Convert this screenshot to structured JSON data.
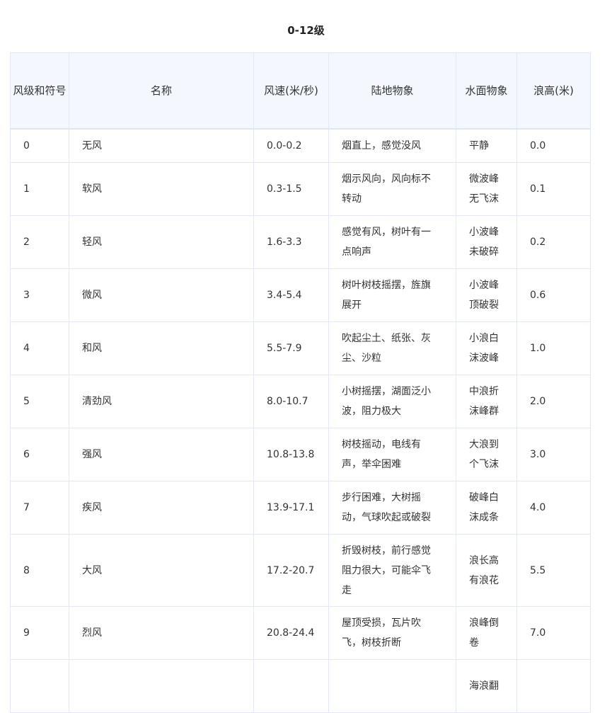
{
  "caption": "0-12级",
  "headers": {
    "level": [
      "风级",
      "和符",
      "号"
    ],
    "name": "名称",
    "speed": [
      "风速",
      "(米/",
      "秒)"
    ],
    "land": "陆地物象",
    "water": [
      "水面",
      "物象"
    ],
    "wave": [
      "浪高",
      "(米)"
    ]
  },
  "rows": [
    {
      "level": "0",
      "name": "无风",
      "speed": "0.0-0.2",
      "land": [
        "烟直上，感觉没风"
      ],
      "water": [
        "平静"
      ],
      "wave": "0.0"
    },
    {
      "level": "1",
      "name": "软风",
      "speed": "0.3-1.5",
      "land": [
        "烟示风向，风向标不",
        "转动"
      ],
      "water": [
        "微波峰",
        "无飞沫"
      ],
      "wave": "0.1"
    },
    {
      "level": "2",
      "name": "轻风",
      "speed": "1.6-3.3",
      "land": [
        "感觉有风，树叶有一",
        "点响声"
      ],
      "water": [
        "小波峰",
        "未破碎"
      ],
      "wave": "0.2"
    },
    {
      "level": "3",
      "name": "微风",
      "speed": "3.4-5.4",
      "land": [
        "树叶树枝摇摆，旌旗",
        "展开"
      ],
      "water": [
        "小波峰",
        "顶破裂"
      ],
      "wave": "0.6"
    },
    {
      "level": "4",
      "name": "和风",
      "speed": "5.5-7.9",
      "land": [
        "吹起尘土、纸张、灰",
        "尘、沙粒"
      ],
      "water": [
        "小浪白",
        "沫波峰"
      ],
      "wave": "1.0"
    },
    {
      "level": "5",
      "name": "清劲风",
      "speed": "8.0-10.7",
      "land": [
        "小树摇摆，湖面泛小",
        "波，阻力极大"
      ],
      "water": [
        "中浪折",
        "沫峰群"
      ],
      "wave": "2.0"
    },
    {
      "level": "6",
      "name": "强风",
      "speed": "10.8-13.8",
      "land": [
        "树枝摇动，电线有",
        "声，举伞困难"
      ],
      "water": [
        "大浪到",
        "个飞沫"
      ],
      "wave": "3.0"
    },
    {
      "level": "7",
      "name": "疾风",
      "speed": "13.9-17.1",
      "land": [
        "步行困难，大树摇",
        "动，气球吹起或破裂"
      ],
      "water": [
        "破峰白",
        "沫成条"
      ],
      "wave": "4.0"
    },
    {
      "level": "8",
      "name": "大风",
      "speed": "17.2-20.7",
      "land": [
        "折毁树枝，前行感觉",
        "阻力很大，可能伞飞",
        "走"
      ],
      "water": [
        "浪长高",
        "有浪花"
      ],
      "wave": "5.5"
    },
    {
      "level": "9",
      "name": "烈风",
      "speed": "20.8-24.4",
      "land": [
        "屋顶受损，瓦片吹",
        "飞，树枝折断"
      ],
      "water": [
        "浪峰倒",
        "卷"
      ],
      "wave": "7.0"
    },
    {
      "level": "",
      "name": "",
      "speed": "",
      "land": [
        ""
      ],
      "water": [
        "海浪翻"
      ],
      "wave": ""
    }
  ]
}
